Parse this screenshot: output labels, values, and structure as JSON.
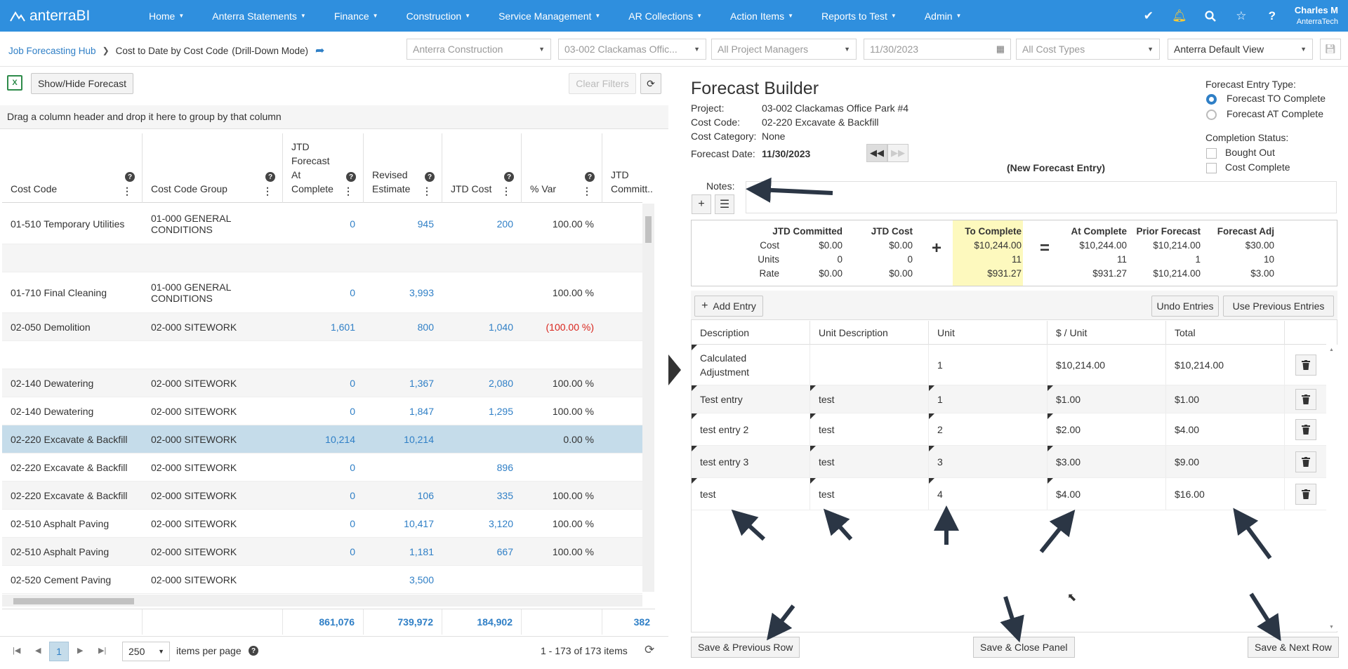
{
  "app": {
    "brand": "anterraBI"
  },
  "nav": {
    "items": [
      "Home",
      "Anterra Statements",
      "Finance",
      "Construction",
      "Service Management",
      "AR Collections",
      "Action Items",
      "Reports to Test",
      "Admin"
    ],
    "user_name": "Charles M",
    "user_org": "AnterraTech"
  },
  "breadcrumb": {
    "root": "Job Forecasting Hub",
    "current": "Cost to Date by Cost Code",
    "mode": "(Drill-Down Mode)"
  },
  "filters": {
    "company": "Anterra Construction",
    "project": "03-002 Clackamas Offic...",
    "managers": "All Project Managers",
    "date": "11/30/2023",
    "cost_types": "All Cost Types",
    "view": "Anterra Default View"
  },
  "grid_toolbar": {
    "show_hide": "Show/Hide Forecast",
    "clear_filters": "Clear Filters"
  },
  "group_hint": "Drag a column header and drop it here to group by that column",
  "columns": [
    "Cost Code",
    "Cost Code Group",
    "JTD Forecast At Complete",
    "Revised Estimate",
    "JTD Cost",
    "% Var",
    "JTD Committ..."
  ],
  "rows": [
    {
      "code": "01-510 Temporary Utilities",
      "group": "01-000 GENERAL CONDITIONS",
      "fac": "0",
      "rev": "945",
      "cost": "200",
      "var": "100.00 %"
    },
    {
      "code": "",
      "group": "",
      "fac": "",
      "rev": "",
      "cost": "",
      "var": ""
    },
    {
      "code": "01-710 Final Cleaning",
      "group": "01-000 GENERAL CONDITIONS",
      "fac": "0",
      "rev": "3,993",
      "cost": "",
      "var": "100.00 %"
    },
    {
      "code": "02-050 Demolition",
      "group": "02-000 SITEWORK",
      "fac": "1,601",
      "rev": "800",
      "cost": "1,040",
      "var": "(100.00 %)"
    },
    {
      "code": "",
      "group": "",
      "fac": "",
      "rev": "",
      "cost": "",
      "var": ""
    },
    {
      "code": "02-140 Dewatering",
      "group": "02-000 SITEWORK",
      "fac": "0",
      "rev": "1,367",
      "cost": "2,080",
      "var": "100.00 %"
    },
    {
      "code": "02-140 Dewatering",
      "group": "02-000 SITEWORK",
      "fac": "0",
      "rev": "1,847",
      "cost": "1,295",
      "var": "100.00 %"
    },
    {
      "code": "02-220 Excavate & Backfill",
      "group": "02-000 SITEWORK",
      "fac": "10,214",
      "rev": "10,214",
      "cost": "",
      "var": "0.00 %"
    },
    {
      "code": "02-220 Excavate & Backfill",
      "group": "02-000 SITEWORK",
      "fac": "0",
      "rev": "",
      "cost": "896",
      "var": ""
    },
    {
      "code": "02-220 Excavate & Backfill",
      "group": "02-000 SITEWORK",
      "fac": "0",
      "rev": "106",
      "cost": "335",
      "var": "100.00 %"
    },
    {
      "code": "02-510 Asphalt Paving",
      "group": "02-000 SITEWORK",
      "fac": "0",
      "rev": "10,417",
      "cost": "3,120",
      "var": "100.00 %"
    },
    {
      "code": "02-510 Asphalt Paving",
      "group": "02-000 SITEWORK",
      "fac": "0",
      "rev": "1,181",
      "cost": "667",
      "var": "100.00 %"
    },
    {
      "code": "02-520 Cement Paving",
      "group": "02-000 SITEWORK",
      "fac": "",
      "rev": "3,500",
      "cost": "",
      "var": ""
    }
  ],
  "totals": {
    "fac": "861,076",
    "rev": "739,972",
    "cost": "184,902",
    "committed": "382"
  },
  "pager": {
    "page": "1",
    "page_size": "250",
    "per_page_label": "items per page",
    "summary": "1 - 173 of 173 items"
  },
  "forecast": {
    "title": "Forecast Builder",
    "project_label": "Project:",
    "project": "03-002 Clackamas Office Park #4",
    "costcode_label": "Cost Code:",
    "costcode": "02-220 Excavate & Backfill",
    "category_label": "Cost Category:",
    "category": "None",
    "date_label": "Forecast Date:",
    "date": "11/30/2023",
    "new_entry": "(New Forecast Entry)",
    "entry_type_label": "Forecast Entry Type:",
    "entry_type_options": [
      "Forecast TO Complete",
      "Forecast AT Complete"
    ],
    "completion_label": "Completion Status:",
    "completion_options": [
      "Bought Out",
      "Cost Complete"
    ],
    "notes_label": "Notes:"
  },
  "summary": {
    "headers": [
      "JTD Committed",
      "JTD Cost",
      "To Complete",
      "At Complete",
      "Prior Forecast",
      "Forecast Adj"
    ],
    "row_labels": [
      "Cost",
      "Units",
      "Rate"
    ],
    "values": [
      [
        "$0.00",
        "$0.00",
        "$10,244.00",
        "$10,244.00",
        "$10,214.00",
        "$30.00"
      ],
      [
        "0",
        "0",
        "11",
        "11",
        "1",
        "10"
      ],
      [
        "$0.00",
        "$0.00",
        "$931.27",
        "$931.27",
        "$10,214.00",
        "$3.00"
      ]
    ],
    "plus": "+",
    "equals": "="
  },
  "entries_toolbar": {
    "add": "Add Entry",
    "undo": "Undo Entries",
    "use_prev": "Use Previous Entries"
  },
  "entry_columns": [
    "Description",
    "Unit Description",
    "Unit",
    "$ / Unit",
    "Total"
  ],
  "entries": [
    {
      "desc": "Calculated Adjustment",
      "unit_desc": "",
      "unit": "1",
      "per_unit": "$10,214.00",
      "total": "$10,214.00"
    },
    {
      "desc": "Test entry",
      "unit_desc": "test",
      "unit": "1",
      "per_unit": "$1.00",
      "total": "$1.00"
    },
    {
      "desc": "test entry 2",
      "unit_desc": "test",
      "unit": "2",
      "per_unit": "$2.00",
      "total": "$4.00"
    },
    {
      "desc": "test entry 3",
      "unit_desc": "test",
      "unit": "3",
      "per_unit": "$3.00",
      "total": "$9.00"
    },
    {
      "desc": "test",
      "unit_desc": "test",
      "unit": "4",
      "per_unit": "$4.00",
      "total": "$16.00"
    }
  ],
  "footer": {
    "prev": "Save & Previous Row",
    "close": "Save & Close Panel",
    "next": "Save & Next Row"
  },
  "colors": {
    "nav": "#2f8fde",
    "link": "#2f7fc6",
    "selected_row": "#c5dcea",
    "to_complete": "#fdf9be",
    "negative": "#d9241c"
  }
}
